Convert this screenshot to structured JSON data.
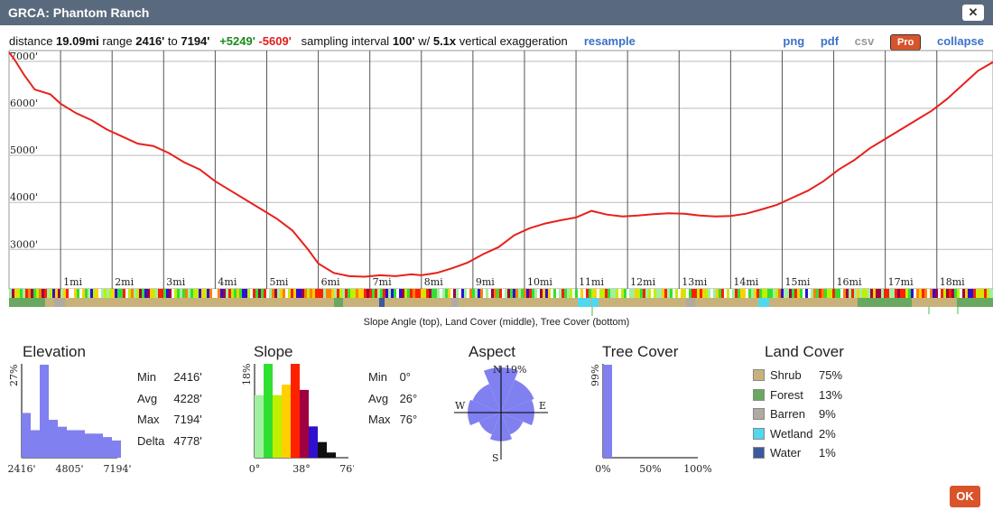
{
  "window": {
    "title": "GRCA: Phantom Ranch"
  },
  "info": {
    "distance_label": "distance",
    "distance": "19.09mi",
    "range_label": "range",
    "range_min": "2416'",
    "range_to": "to",
    "range_max": "7194'",
    "gain": "+5249'",
    "loss": "-5609'",
    "sampling_label": "sampling interval",
    "interval": "100'",
    "w_label": "w/",
    "exaggeration": "5.1x",
    "exaggeration_label": "vertical exaggeration",
    "resample": "resample"
  },
  "toolbar": {
    "png": "png",
    "pdf": "pdf",
    "csv": "csv",
    "pro": "Pro",
    "collapse": "collapse"
  },
  "profile_caption": "Slope Angle (top), Land Cover (middle), Tree Cover (bottom)",
  "colors": {
    "profile_line": "#e8201c",
    "hist_fill": "#8080f0",
    "titlebar": "#5a6a7e",
    "accent": "#d9542b"
  },
  "chart_data": [
    {
      "type": "line",
      "name": "elevation-profile",
      "x_unit": "mi",
      "y_unit": "ft",
      "xlim": [
        0,
        19.09
      ],
      "ylim": [
        2160,
        7230
      ],
      "yticks": [
        3000,
        4000,
        5000,
        6000,
        7000
      ],
      "ytick_labels": [
        "3000'",
        "4000'",
        "5000'",
        "6000'",
        "7000'"
      ],
      "xticks": [
        1,
        2,
        3,
        4,
        5,
        6,
        7,
        8,
        9,
        10,
        11,
        12,
        13,
        14,
        15,
        16,
        17,
        18
      ],
      "xtick_labels": [
        "1mi",
        "2mi",
        "3mi",
        "4mi",
        "5mi",
        "6mi",
        "7mi",
        "8mi",
        "9mi",
        "10mi",
        "11mi",
        "12mi",
        "13mi",
        "14mi",
        "15mi",
        "16mi",
        "17mi",
        "18mi"
      ],
      "x": [
        0,
        0.1,
        0.3,
        0.5,
        0.8,
        1.0,
        1.3,
        1.6,
        1.9,
        2.2,
        2.5,
        2.8,
        3.1,
        3.4,
        3.7,
        4.0,
        4.3,
        4.6,
        4.9,
        5.2,
        5.5,
        5.8,
        6.0,
        6.3,
        6.6,
        6.9,
        7.2,
        7.5,
        7.8,
        8.0,
        8.3,
        8.6,
        8.9,
        9.2,
        9.5,
        9.8,
        10.1,
        10.4,
        10.7,
        11.0,
        11.3,
        11.6,
        11.9,
        12.2,
        12.5,
        12.8,
        13.1,
        13.4,
        13.7,
        14.0,
        14.3,
        14.6,
        14.9,
        15.2,
        15.5,
        15.8,
        16.1,
        16.4,
        16.7,
        17.0,
        17.3,
        17.6,
        17.9,
        18.2,
        18.5,
        18.8,
        19.09
      ],
      "y": [
        7194,
        7050,
        6700,
        6400,
        6300,
        6100,
        5900,
        5750,
        5550,
        5400,
        5250,
        5200,
        5050,
        4850,
        4700,
        4450,
        4250,
        4050,
        3850,
        3650,
        3400,
        3000,
        2700,
        2500,
        2430,
        2420,
        2450,
        2430,
        2470,
        2450,
        2500,
        2600,
        2720,
        2900,
        3050,
        3300,
        3450,
        3550,
        3620,
        3680,
        3820,
        3740,
        3700,
        3720,
        3750,
        3770,
        3760,
        3720,
        3700,
        3710,
        3760,
        3850,
        3950,
        4100,
        4250,
        4450,
        4700,
        4900,
        5150,
        5350,
        5550,
        5750,
        5950,
        6200,
        6500,
        6800,
        6984
      ]
    },
    {
      "type": "bar",
      "name": "elevation-histogram",
      "title": "Elevation",
      "ylabel": "27%",
      "xtick_labels": [
        "2416'",
        "4805'",
        "7194'"
      ],
      "values": [
        13,
        8,
        27,
        11,
        9,
        8,
        8,
        7,
        7,
        6,
        5
      ],
      "ylim": [
        0,
        27
      ],
      "stats": [
        {
          "label": "Min",
          "value": "2416'"
        },
        {
          "label": "Avg",
          "value": "4228'"
        },
        {
          "label": "Max",
          "value": "7194'"
        },
        {
          "label": "Delta",
          "value": "4778'"
        }
      ]
    },
    {
      "type": "bar",
      "name": "slope-histogram",
      "title": "Slope",
      "ylabel": "18%",
      "xtick_labels": [
        "0°",
        "38°",
        "76°"
      ],
      "values": [
        12,
        18,
        12,
        14,
        18,
        13,
        6,
        3,
        1
      ],
      "colors": [
        "#a0f0a0",
        "#30e030",
        "#c0f000",
        "#ffd000",
        "#ff2000",
        "#a00040",
        "#3010d0",
        "#101010",
        "#101010"
      ],
      "ylim": [
        0,
        18
      ],
      "stats": [
        {
          "label": "Min",
          "value": "0°"
        },
        {
          "label": "Avg",
          "value": "26°"
        },
        {
          "label": "Max",
          "value": "76°"
        }
      ]
    },
    {
      "type": "polar",
      "name": "aspect-rose",
      "title": "Aspect",
      "max_label": "19%",
      "directions": [
        "N",
        "E",
        "S",
        "W"
      ],
      "values": [
        19,
        15,
        14,
        10,
        12,
        10,
        14,
        13
      ]
    },
    {
      "type": "bar",
      "name": "tree-cover-histogram",
      "title": "Tree Cover",
      "ylabel": "99%",
      "xtick_labels": [
        "0%",
        "50%",
        "100%"
      ],
      "values": [
        99
      ],
      "ylim": [
        0,
        99
      ]
    },
    {
      "type": "table",
      "name": "land-cover",
      "title": "Land Cover",
      "rows": [
        {
          "label": "Shrub",
          "value": "75%",
          "color": "#c8b27a"
        },
        {
          "label": "Forest",
          "value": "13%",
          "color": "#68a860"
        },
        {
          "label": "Barren",
          "value": "9%",
          "color": "#b0aaa0"
        },
        {
          "label": "Wetland",
          "value": "2%",
          "color": "#4fd8f0"
        },
        {
          "label": "Water",
          "value": "1%",
          "color": "#3c5a9a"
        }
      ]
    }
  ],
  "ok_button": "OK"
}
